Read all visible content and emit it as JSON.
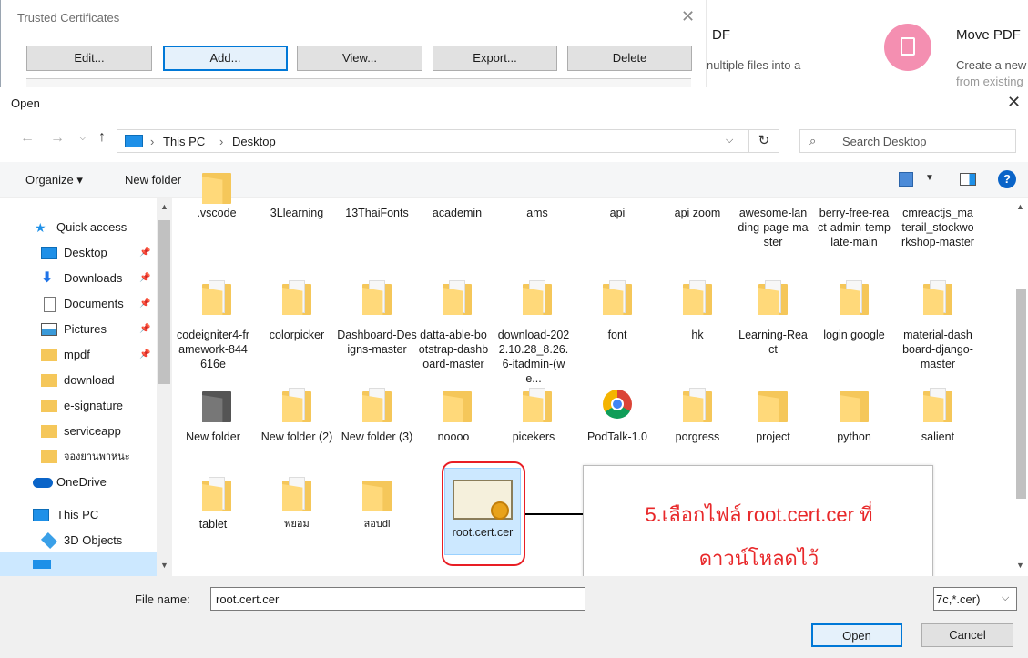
{
  "bg_window": {
    "title": "Trusted Certificates",
    "buttons": [
      "Edit...",
      "Add...",
      "View...",
      "Export...",
      "Delete"
    ]
  },
  "bg_pdf": {
    "card1_title_partial": "DF",
    "card1_desc_partial": "nultiple files into a",
    "card2_title": "Move PDF",
    "card2_desc": "Create a new",
    "card2_desc2": "from existing"
  },
  "dialog": {
    "title": "Open",
    "breadcrumb": [
      "This PC",
      "Desktop"
    ],
    "search_placeholder": "Search Desktop",
    "toolbar": {
      "organize": "Organize ▾",
      "new_folder": "New folder"
    }
  },
  "nav": {
    "items": [
      {
        "label": "Quick access",
        "icon": "star-icon",
        "pinned": false
      },
      {
        "label": "Desktop",
        "icon": "desktop-icon",
        "pinned": true
      },
      {
        "label": "Downloads",
        "icon": "download-icon",
        "pinned": true
      },
      {
        "label": "Documents",
        "icon": "documents-icon",
        "pinned": true
      },
      {
        "label": "Pictures",
        "icon": "pictures-icon",
        "pinned": true
      },
      {
        "label": "mpdf",
        "icon": "folder-icon",
        "pinned": true
      },
      {
        "label": "download",
        "icon": "folder-icon",
        "pinned": false
      },
      {
        "label": "e-signature",
        "icon": "folder-icon",
        "pinned": false
      },
      {
        "label": "serviceapp",
        "icon": "folder-icon",
        "pinned": false
      },
      {
        "label": "จองยานพาหนะ",
        "icon": "folder-icon",
        "pinned": false
      },
      {
        "label": "OneDrive",
        "icon": "cloud-icon",
        "pinned": false
      },
      {
        "label": "This PC",
        "icon": "computer-icon",
        "pinned": false
      },
      {
        "label": "3D Objects",
        "icon": "cube-icon",
        "pinned": false
      }
    ]
  },
  "files": {
    "row1": [
      ".vscode",
      "3Llearning",
      "13ThaiFonts",
      "academin",
      "ams",
      "api",
      "api zoom",
      "awesome-landing-page-master",
      "berry-free-react-admin-template-main",
      "cmreactjs_materail_stockworkshop-master"
    ],
    "row2": [
      "codeigniter4-framework-844616e",
      "colorpicker",
      "Dashboard-Designs-master",
      "datta-able-bootstrap-dashboard-master",
      "download-2022.10.28_8.26.6-itadmin-(we...",
      "font",
      "hk",
      "Learning-React",
      "login google",
      "material-dashboard-django-master"
    ],
    "row3": [
      "New folder",
      "New folder (2)",
      "New folder (3)",
      "noooo",
      "picekers",
      "PodTalk-1.0",
      "porgress",
      "project",
      "python",
      "salient"
    ],
    "row4": [
      "tablet",
      "พยอม",
      "สอบdl",
      "root.cert.cer"
    ]
  },
  "callout": {
    "line1": "5.เลือกไฟล์ root.cert.cer ที่",
    "line2": "ดาวน์โหลดไว้"
  },
  "bottom": {
    "filename_label": "File name:",
    "filename_value": "root.cert.cer",
    "filter_partial": "7c,*.cer)",
    "open": "Open",
    "cancel": "Cancel"
  },
  "colors": {
    "accent": "#0078d7",
    "callout_text": "#e8282a",
    "highlight_ring": "#e81e25",
    "selected_bg": "#cce8ff"
  }
}
